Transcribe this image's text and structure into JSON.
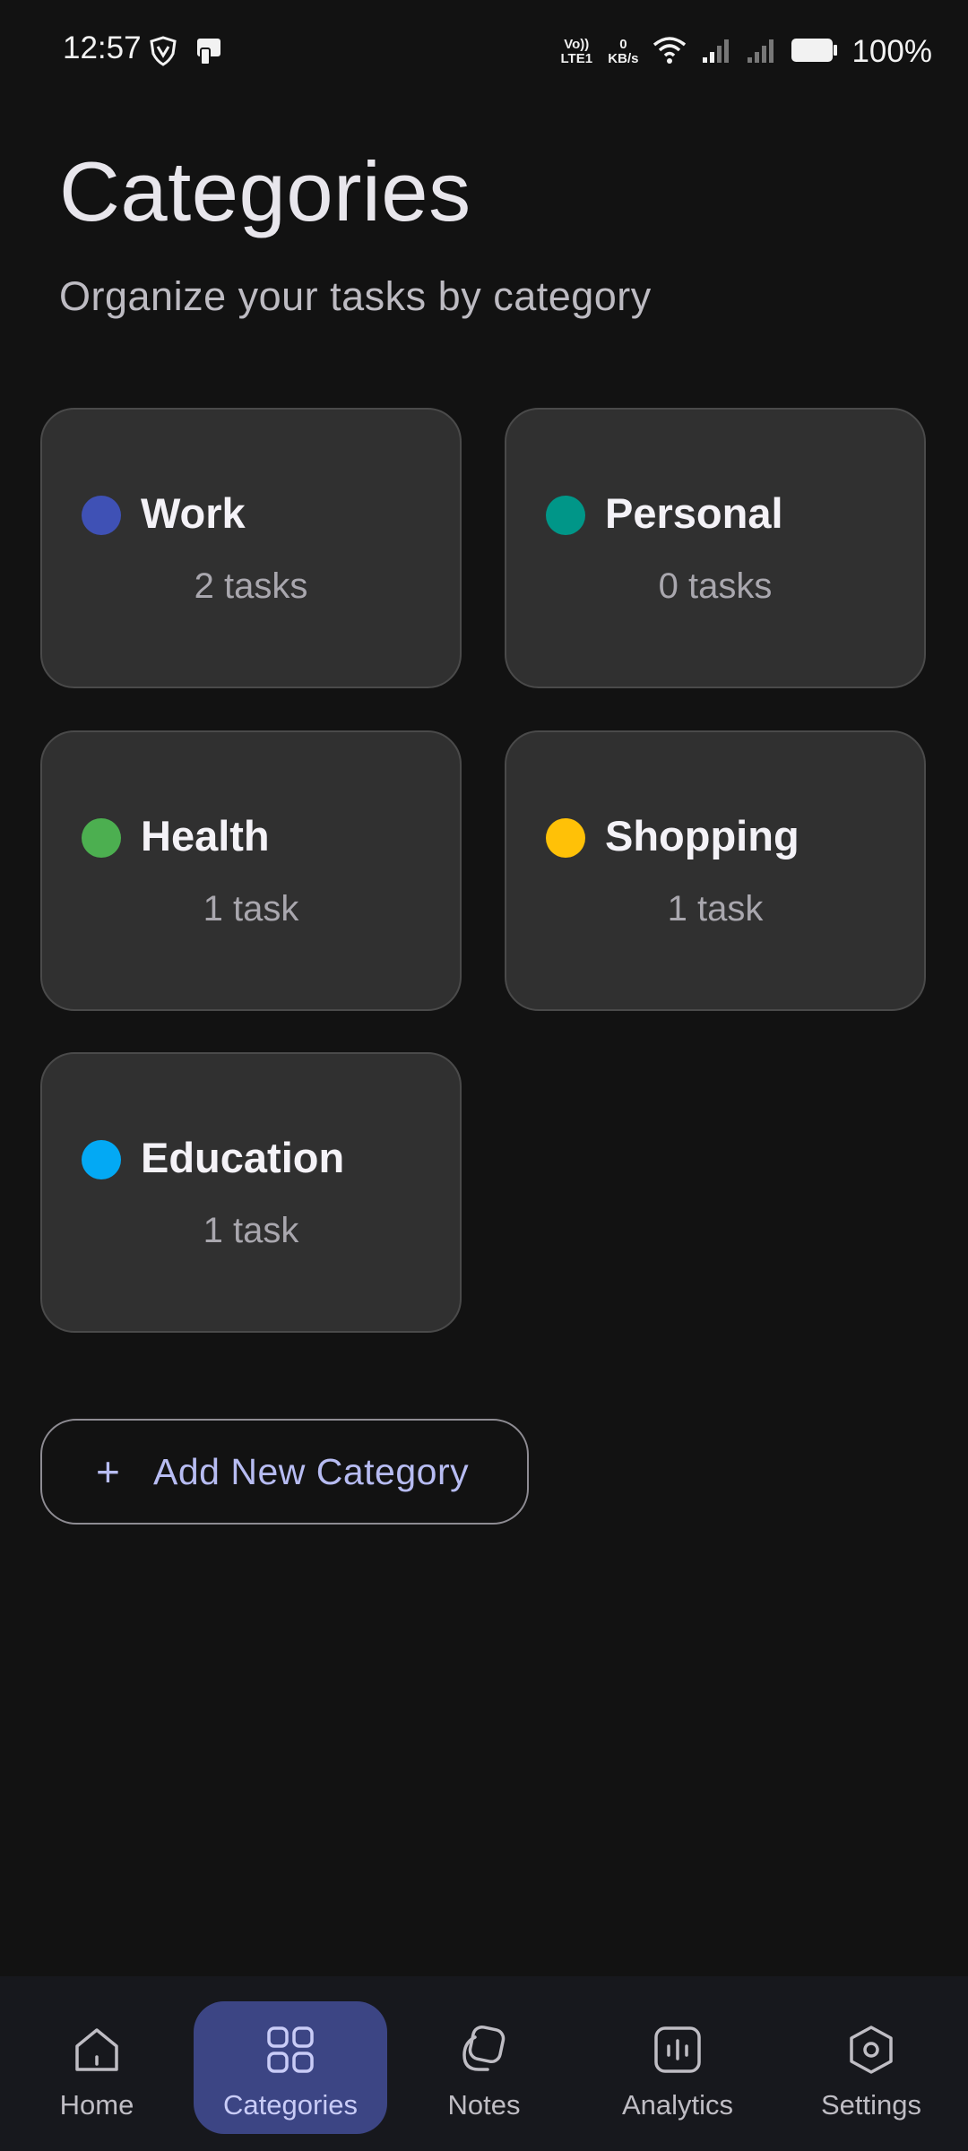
{
  "status_bar": {
    "time": "12:57",
    "volte": "Vo)) LTE1",
    "speed_value": "0",
    "speed_unit": "KB/s",
    "battery": "100%"
  },
  "header": {
    "title": "Categories",
    "subtitle": "Organize your tasks by category"
  },
  "categories": [
    {
      "name": "Work",
      "count": "2 tasks",
      "color": "#3F51B5"
    },
    {
      "name": "Personal",
      "count": "0 tasks",
      "color": "#009688"
    },
    {
      "name": "Health",
      "count": "1 task",
      "color": "#4CAF50"
    },
    {
      "name": "Shopping",
      "count": "1 task",
      "color": "#FFC107"
    },
    {
      "name": "Education",
      "count": "1 task",
      "color": "#03A9F4"
    }
  ],
  "add_button": {
    "plus": "+",
    "label": "Add New Category"
  },
  "nav": {
    "items": [
      {
        "label": "Home",
        "icon": "home-icon"
      },
      {
        "label": "Categories",
        "icon": "grid-icon",
        "active": true
      },
      {
        "label": "Notes",
        "icon": "notes-icon"
      },
      {
        "label": "Analytics",
        "icon": "analytics-icon"
      },
      {
        "label": "Settings",
        "icon": "settings-icon"
      }
    ]
  },
  "colors": {
    "background": "#121212",
    "card": "#303030",
    "accent": "#3c4584",
    "accent_text": "#b7bcf2"
  }
}
